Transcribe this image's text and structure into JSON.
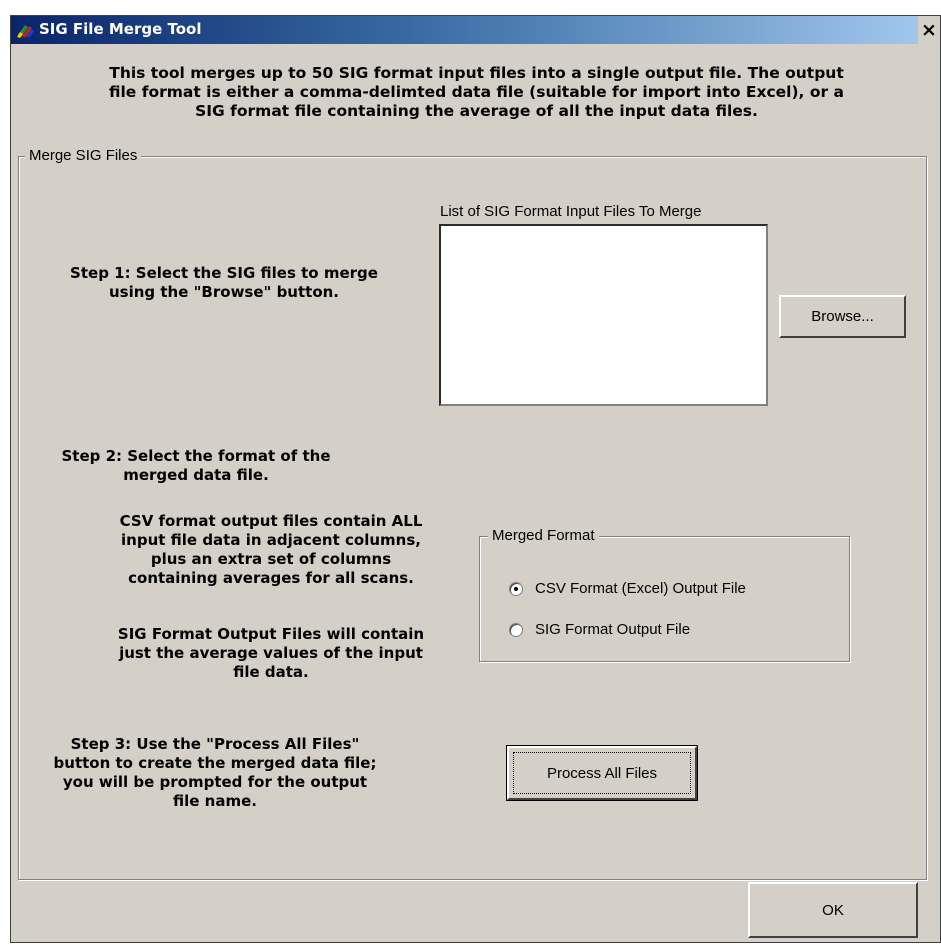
{
  "window": {
    "title": "SIG File Merge Tool",
    "close_label": "×"
  },
  "intro": {
    "line1": "This tool merges up to 50 SIG format input files into a single output file. The output",
    "line2": "file format is either a comma-delimted data file (suitable for import into Excel),  or a",
    "line3": "SIG format file containing the average of all the input data files."
  },
  "merge_group": {
    "legend": "Merge SIG Files",
    "list_label": "List of SIG Format Input Files To Merge",
    "files": [],
    "browse_label": "Browse...",
    "step1": [
      "Step 1: Select the SIG files to merge",
      "using the \"Browse\" button."
    ],
    "step2": [
      "Step 2: Select the format of the",
      "merged data file."
    ],
    "csv_note": [
      "CSV format output files contain ALL",
      "input file data in adjacent columns,",
      "plus an extra set of columns",
      "containing averages for all scans."
    ],
    "sig_note": [
      "SIG Format Output Files will contain",
      "just the average values of the input",
      "file data."
    ],
    "step3": [
      "Step 3: Use the \"Process All Files\"",
      "button to create the merged data file;",
      "you will be prompted for the output",
      "file name."
    ],
    "process_label": "Process All Files"
  },
  "format_group": {
    "legend": "Merged Format",
    "options": [
      {
        "label": "CSV Format (Excel) Output File",
        "selected": true
      },
      {
        "label": "SIG Format Output File",
        "selected": false
      }
    ]
  },
  "ok_label": "OK",
  "colors": {
    "dialog_face": "#d4d0c8",
    "title_start": "#0a246a",
    "title_end": "#a6caf0"
  }
}
